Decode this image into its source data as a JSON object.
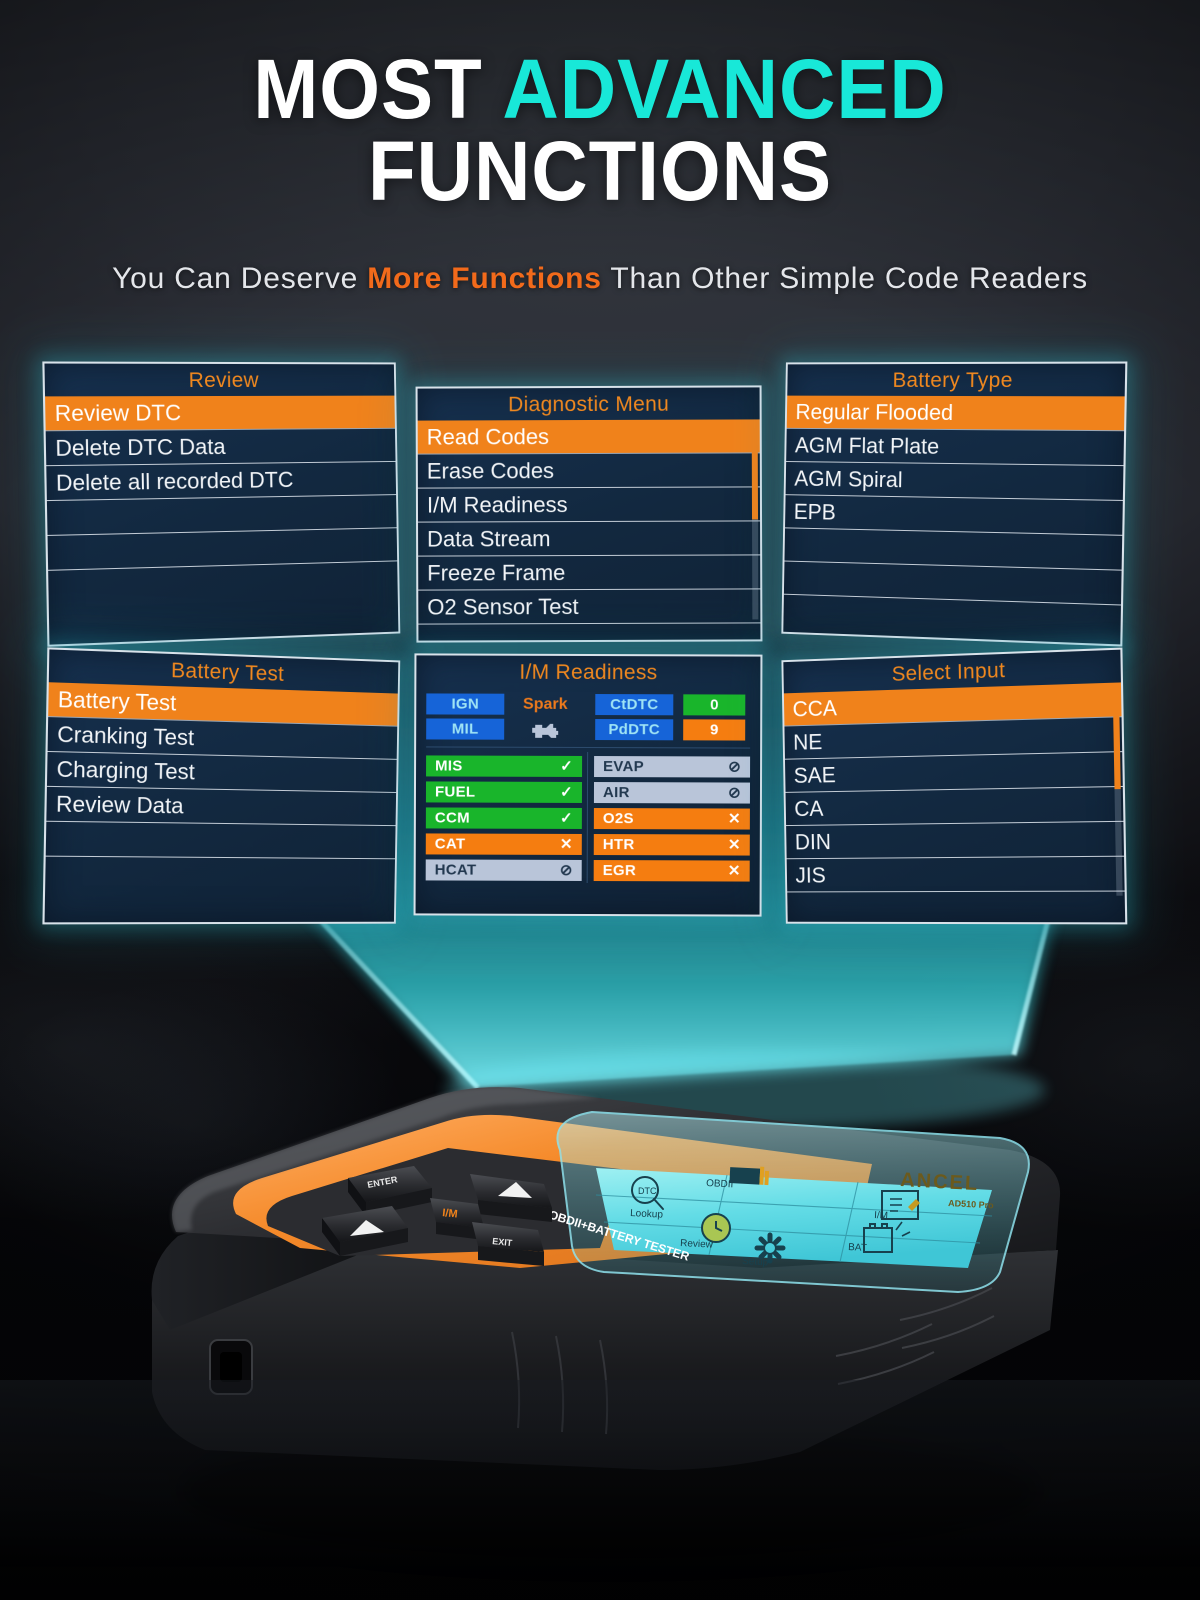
{
  "headline": {
    "line1_a": "MOST ",
    "line1_b": "ADVANCED",
    "line2": "FUNCTIONS",
    "accent_color": "#18e8d8"
  },
  "subtitle": {
    "before": "You Can Deserve ",
    "highlight": "More Functions",
    "after": " Than Other Simple Code Readers",
    "highlight_color": "#f26a1b"
  },
  "theme": {
    "panel_bg": "#16304e",
    "panel_border": "#d8e2ea",
    "glow": "#2dbecd",
    "orange": "#f0821b",
    "title_orange": "#f0881f",
    "green": "#19b52b",
    "blue": "#1664d8",
    "grey_chip": "#b9c5d9"
  },
  "panels": [
    {
      "id": "review",
      "title": "Review",
      "selected_index": 0,
      "scrollbar": false,
      "items": [
        "Review DTC",
        "Delete DTC Data",
        "Delete all recorded DTC",
        "",
        "",
        ""
      ]
    },
    {
      "id": "diagnostic-menu",
      "title": "Diagnostic Menu",
      "selected_index": 0,
      "scrollbar": true,
      "scroll_top_pct": 0,
      "scroll_height_pct": 50,
      "items": [
        "Read Codes",
        "Erase Codes",
        "I/M Readiness",
        "Data Stream",
        "Freeze Frame",
        "O2 Sensor Test"
      ]
    },
    {
      "id": "battery-type",
      "title": "Battery Type",
      "selected_index": 0,
      "scrollbar": false,
      "items": [
        "Regular Flooded",
        "AGM Flat Plate",
        "AGM Spiral",
        "EPB",
        "",
        ""
      ]
    },
    {
      "id": "battery-test",
      "title": "Battery Test",
      "selected_index": 0,
      "scrollbar": false,
      "items": [
        "Battery Test",
        "Cranking Test",
        "Charging Test",
        "Review Data",
        "",
        ""
      ]
    },
    {
      "id": "select-input",
      "title": "Select Input",
      "selected_index": 0,
      "scrollbar": true,
      "scroll_top_pct": 0,
      "scroll_height_pct": 50,
      "items": [
        "CCA",
        "NE",
        "SAE",
        "CA",
        "DIN",
        "JIS"
      ]
    }
  ],
  "im_readiness": {
    "title": "I/M Readiness",
    "top_left": [
      {
        "tag": "IGN",
        "value": "Spark",
        "value_kind": "text"
      },
      {
        "tag": "MIL",
        "value": "engine-icon",
        "value_kind": "icon"
      }
    ],
    "top_right": [
      {
        "tag": "CtDTC",
        "value": "0",
        "value_kind": "badge",
        "status": "green"
      },
      {
        "tag": "PdDTC",
        "value": "9",
        "value_kind": "badge",
        "status": "orange"
      }
    ],
    "left_chips": [
      {
        "label": "MIS",
        "status": "green",
        "glyph": "check"
      },
      {
        "label": "FUEL",
        "status": "green",
        "glyph": "check"
      },
      {
        "label": "CCM",
        "status": "green",
        "glyph": "check"
      },
      {
        "label": "CAT",
        "status": "orange",
        "glyph": "cross"
      },
      {
        "label": "HCAT",
        "status": "grey",
        "glyph": "na"
      }
    ],
    "right_chips": [
      {
        "label": "EVAP",
        "status": "grey",
        "glyph": "na"
      },
      {
        "label": "AIR",
        "status": "grey",
        "glyph": "na"
      },
      {
        "label": "O2S",
        "status": "orange",
        "glyph": "cross"
      },
      {
        "label": "HTR",
        "status": "orange",
        "glyph": "cross"
      },
      {
        "label": "EGR",
        "status": "orange",
        "glyph": "cross"
      }
    ]
  },
  "device": {
    "body_label": "OBDII+BATTERY TESTER",
    "brand": "ANCEL",
    "model": "AD510 Pro",
    "screen_tiles": [
      {
        "label": "Lookup",
        "icon": "dtc-lookup-icon"
      },
      {
        "label": "OBDII",
        "icon": "obdii-icon"
      },
      {
        "label": "I/M",
        "icon": "im-readiness-icon"
      },
      {
        "label": "Review",
        "icon": "review-clock-icon"
      },
      {
        "label": "BAT",
        "icon": "battery-icon"
      },
      {
        "label": "Setup",
        "icon": "gear-icon"
      }
    ],
    "keys": [
      {
        "label": "ENTER",
        "name": "enter-key"
      },
      {
        "label": "EXIT",
        "name": "exit-key"
      },
      {
        "label": "▲",
        "name": "up-key"
      },
      {
        "label": "▲",
        "name": "down-key"
      },
      {
        "label": "I/M",
        "name": "im-hotkey"
      }
    ]
  }
}
